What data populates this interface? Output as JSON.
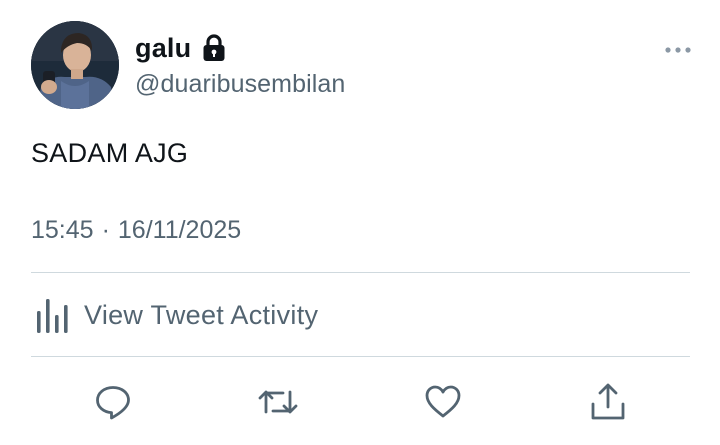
{
  "author": {
    "display_name": "galu",
    "handle": "@duaribusembilan",
    "protected": true,
    "avatar_icon": "profile-photo"
  },
  "tweet": {
    "text": "SADAM AJG",
    "time": "15:45",
    "separator": "·",
    "date": "16/11/2025"
  },
  "activity": {
    "label": "View Tweet Activity",
    "icon": "bar-chart-icon"
  },
  "actions": {
    "reply_icon": "reply-icon",
    "retweet_icon": "retweet-icon",
    "like_icon": "heart-icon",
    "share_icon": "share-icon"
  },
  "colors": {
    "text_primary": "#0f1419",
    "text_secondary": "#536471",
    "divider": "#cfd9de"
  }
}
